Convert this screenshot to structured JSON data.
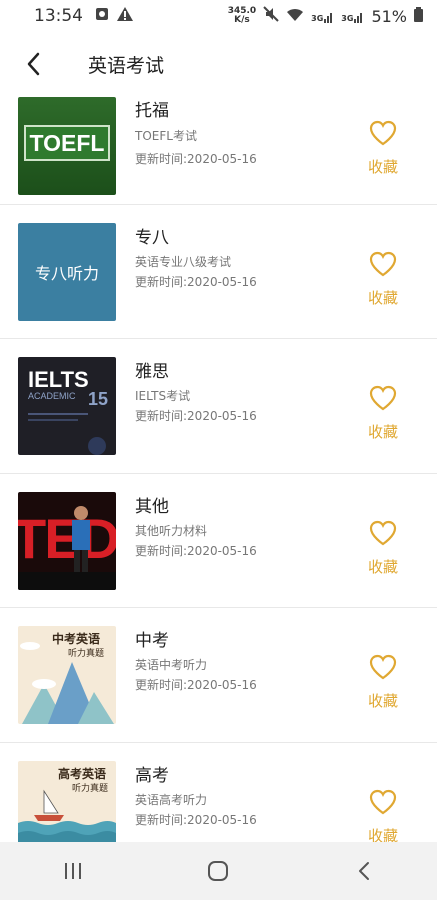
{
  "status": {
    "time": "13:54",
    "net_speed_value": "345.0",
    "net_speed_unit": "K/s",
    "signal1": "3G",
    "signal2": "3G",
    "battery": "51%"
  },
  "header": {
    "title": "英语考试",
    "back_icon": "chevron-left-icon"
  },
  "items": [
    {
      "title": "托福",
      "subtitle": "TOEFL考试",
      "date": "更新时间:2020-05-16",
      "fav_label": "收藏",
      "thumb_text": "TOEFL"
    },
    {
      "title": "专八",
      "subtitle": "英语专业八级考试",
      "date": "更新时间:2020-05-16",
      "fav_label": "收藏",
      "thumb_text": "专八听力"
    },
    {
      "title": "雅思",
      "subtitle": "IELTS考试",
      "date": "更新时间:2020-05-16",
      "fav_label": "收藏",
      "thumb_text": "IELTS",
      "thumb_sub": "ACADEMIC",
      "thumb_num": "15"
    },
    {
      "title": "其他",
      "subtitle": "其他听力材料",
      "date": "更新时间:2020-05-16",
      "fav_label": "收藏",
      "thumb_text": "TED"
    },
    {
      "title": "中考",
      "subtitle": "英语中考听力",
      "date": "更新时间:2020-05-16",
      "fav_label": "收藏",
      "thumb_text": "中考英语",
      "thumb_sub": "听力真题"
    },
    {
      "title": "高考",
      "subtitle": "英语高考听力",
      "date": "更新时间:2020-05-16",
      "fav_label": "收藏",
      "thumb_text": "高考英语",
      "thumb_sub": "听力真题"
    }
  ],
  "colors": {
    "accent": "#e0a832",
    "divider": "#e8e8e8",
    "navbar": "#f2f2f2"
  }
}
